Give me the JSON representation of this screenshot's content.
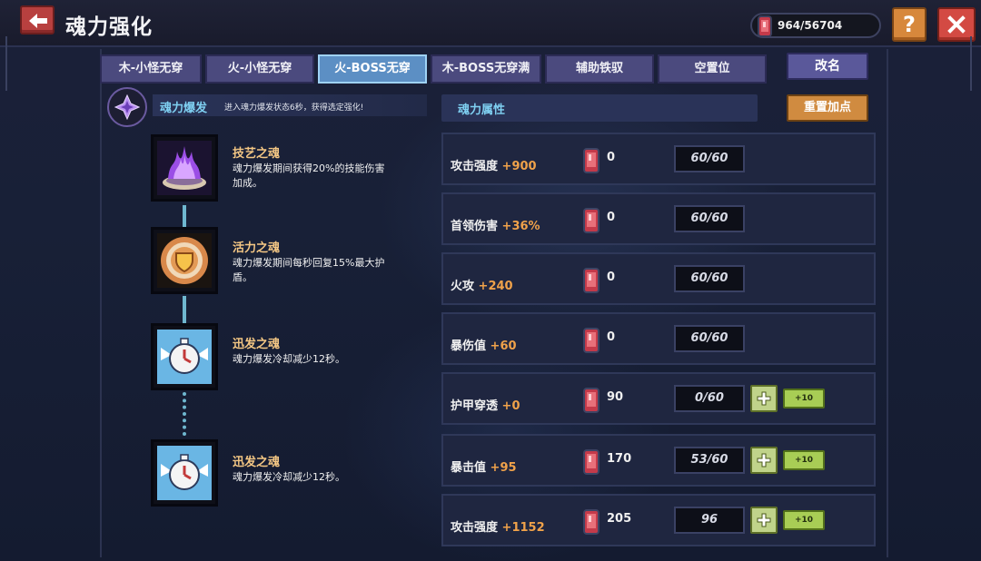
{
  "header": {
    "title": "魂力强化",
    "currency": "964/56704"
  },
  "tabs": [
    {
      "label": "木-小怪无穿",
      "active": false
    },
    {
      "label": "火-小怪无穿",
      "active": false
    },
    {
      "label": "火-BOSS无穿",
      "active": true
    },
    {
      "label": "木-BOSS无穿满",
      "active": false
    },
    {
      "label": "辅助铁驭",
      "active": false
    },
    {
      "label": "空置位",
      "active": false
    }
  ],
  "rename_label": "改名",
  "burst": {
    "title": "魂力爆发",
    "description": "进入魂力爆发状态6秒，获得选定强化!"
  },
  "skills": [
    {
      "name": "技艺之魂",
      "desc_lines": [
        "魂力爆发期间获得20%的技能伤害",
        "加成。"
      ],
      "icon": "purple-flame-icon"
    },
    {
      "name": "活力之魂",
      "desc_lines": [
        "魂力爆发期间每秒回复15%最大护",
        "盾。"
      ],
      "icon": "shield-sun-icon"
    },
    {
      "name": "迅发之魂",
      "desc_lines": [
        "魂力爆发冷却减少12秒。"
      ],
      "icon": "winged-clock-icon"
    },
    {
      "name": "迅发之魂",
      "desc_lines": [
        "魂力爆发冷却减少12秒。"
      ],
      "icon": "winged-clock-icon"
    }
  ],
  "attributes": {
    "header": "魂力属性",
    "reset_label": "重置加点",
    "plus10_label": "+10",
    "rows": [
      {
        "name": "攻击强度",
        "bonus": "+900",
        "cost": "0",
        "level": "60/60",
        "upgradable": false
      },
      {
        "name": "首领伤害",
        "bonus": "+36%",
        "cost": "0",
        "level": "60/60",
        "upgradable": false
      },
      {
        "name": "火攻",
        "bonus": "+240",
        "cost": "0",
        "level": "60/60",
        "upgradable": false
      },
      {
        "name": "暴伤值",
        "bonus": "+60",
        "cost": "0",
        "level": "60/60",
        "upgradable": false
      },
      {
        "name": "护甲穿透",
        "bonus": "+0",
        "cost": "90",
        "level": "0/60",
        "upgradable": true
      },
      {
        "name": "暴击值",
        "bonus": "+95",
        "cost": "170",
        "level": "53/60",
        "upgradable": true
      },
      {
        "name": "攻击强度",
        "bonus": "+1152",
        "cost": "205",
        "level": "96",
        "upgradable": true
      }
    ]
  },
  "colors": {
    "accent_cyan": "#7fd0f2",
    "bonus_orange": "#f0a24a",
    "skill_name_gold": "#f4c784",
    "tab_active": "#5c8fc4"
  }
}
